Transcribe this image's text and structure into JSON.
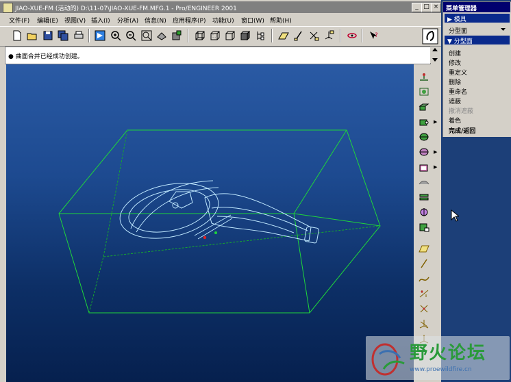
{
  "window": {
    "title": "JIAO-XUE-FM (活动的) D:\\11-07\\JIAO-XUE-FM.MFG.1 - Pro/ENGINEER 2001",
    "buttons": [
      "_",
      "□",
      "×"
    ]
  },
  "menubar": {
    "items": [
      "文件(F)",
      "编辑(E)",
      "视图(V)",
      "插入(I)",
      "分析(A)",
      "信息(N)",
      "应用程序(P)",
      "功能(U)",
      "窗口(W)",
      "帮助(H)"
    ]
  },
  "message": {
    "text": "● 曲面合并已经成功创建。"
  },
  "menu_manager": {
    "title": "菜单管理器",
    "section1": "▶ 模具",
    "dropdown": "分型面",
    "section2": "▼ 分型面",
    "items": [
      "创建",
      "修改",
      "重定义",
      "删除",
      "重命名",
      "遮蔽",
      "撤消遮蔽",
      "着色",
      "完成/返回"
    ],
    "disabled_index": 6
  },
  "watermark": {
    "title": "野火论坛",
    "url": "www.proewildfire.cn"
  },
  "colors": {
    "wireframe": "#1fd63a",
    "model": "#bfe8ff",
    "titlebar_inactive": "#808080",
    "menu_header": "#00006e"
  }
}
